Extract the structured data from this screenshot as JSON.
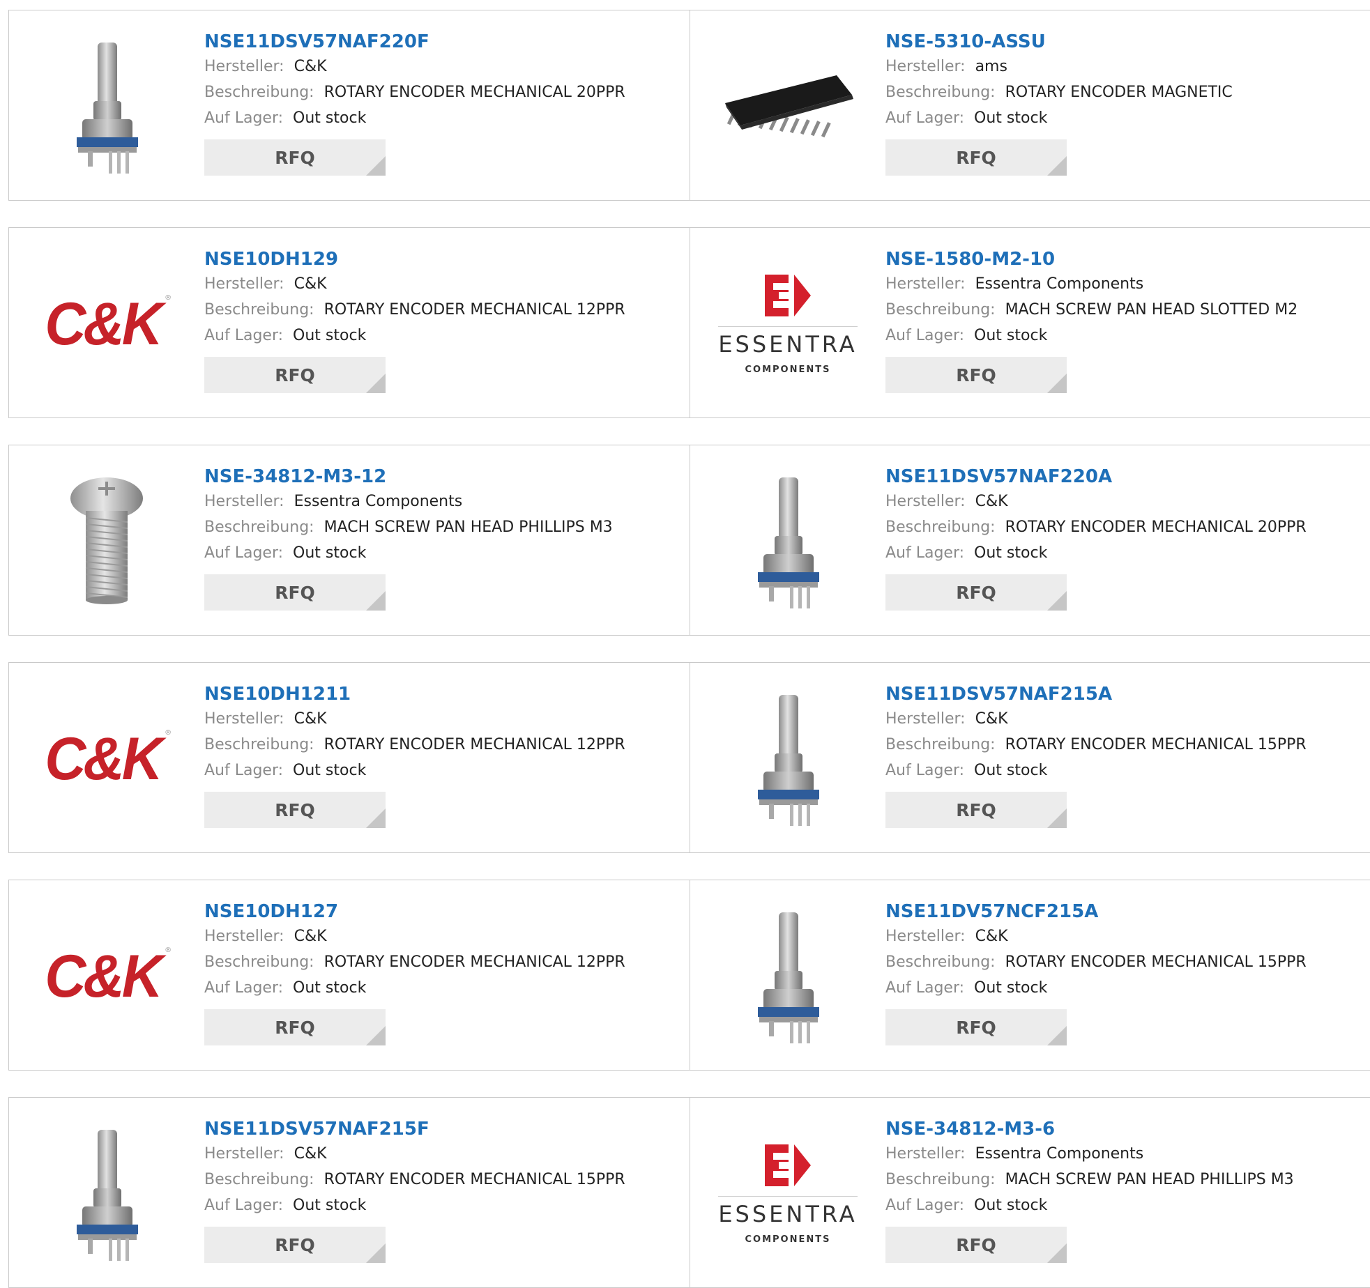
{
  "labels": {
    "manufacturer": "Hersteller:",
    "description": "Beschreibung:",
    "stock": "Auf Lager:",
    "rfq": "RFQ"
  },
  "products": [
    {
      "part": "NSE11DSV57NAF220F",
      "manufacturer": "C&K",
      "description": "ROTARY ENCODER MECHANICAL 20PPR",
      "stock": "Out stock",
      "image": "rotary-encoder-image"
    },
    {
      "part": "NSE-5310-ASSU",
      "manufacturer": "ams",
      "description": "ROTARY ENCODER MAGNETIC",
      "stock": "Out stock",
      "image": "ic-chip-image"
    },
    {
      "part": "NSE10DH129",
      "manufacturer": "C&K",
      "description": "ROTARY ENCODER MECHANICAL 12PPR",
      "stock": "Out stock",
      "image": "ck-logo",
      "logo_text": "C&K"
    },
    {
      "part": "NSE-1580-M2-10",
      "manufacturer": "Essentra Components",
      "description": "MACH SCREW PAN HEAD SLOTTED M2",
      "stock": "Out stock",
      "image": "essentra-logo",
      "logo_text": "ESSENTRA",
      "logo_sub": "COMPONENTS"
    },
    {
      "part": "NSE-34812-M3-12",
      "manufacturer": "Essentra Components",
      "description": "MACH SCREW PAN HEAD PHILLIPS M3",
      "stock": "Out stock",
      "image": "screw-image"
    },
    {
      "part": "NSE11DSV57NAF220A",
      "manufacturer": "C&K",
      "description": "ROTARY ENCODER MECHANICAL 20PPR",
      "stock": "Out stock",
      "image": "rotary-encoder-image"
    },
    {
      "part": "NSE10DH1211",
      "manufacturer": "C&K",
      "description": "ROTARY ENCODER MECHANICAL 12PPR",
      "stock": "Out stock",
      "image": "ck-logo",
      "logo_text": "C&K"
    },
    {
      "part": "NSE11DSV57NAF215A",
      "manufacturer": "C&K",
      "description": "ROTARY ENCODER MECHANICAL 15PPR",
      "stock": "Out stock",
      "image": "rotary-encoder-image"
    },
    {
      "part": "NSE10DH127",
      "manufacturer": "C&K",
      "description": "ROTARY ENCODER MECHANICAL 12PPR",
      "stock": "Out stock",
      "image": "ck-logo",
      "logo_text": "C&K"
    },
    {
      "part": "NSE11DV57NCF215A",
      "manufacturer": "C&K",
      "description": "ROTARY ENCODER MECHANICAL 15PPR",
      "stock": "Out stock",
      "image": "rotary-encoder-image"
    },
    {
      "part": "NSE11DSV57NAF215F",
      "manufacturer": "C&K",
      "description": "ROTARY ENCODER MECHANICAL 15PPR",
      "stock": "Out stock",
      "image": "rotary-encoder-image"
    },
    {
      "part": "NSE-34812-M3-6",
      "manufacturer": "Essentra Components",
      "description": "MACH SCREW PAN HEAD PHILLIPS M3",
      "stock": "Out stock",
      "image": "essentra-logo",
      "logo_text": "ESSENTRA",
      "logo_sub": "COMPONENTS"
    }
  ],
  "colors": {
    "part_link": "#1e6fb8",
    "label": "#8a8a8a",
    "button_bg": "#ececec",
    "ck_red": "#c62229",
    "essentra_red": "#d4202c"
  }
}
